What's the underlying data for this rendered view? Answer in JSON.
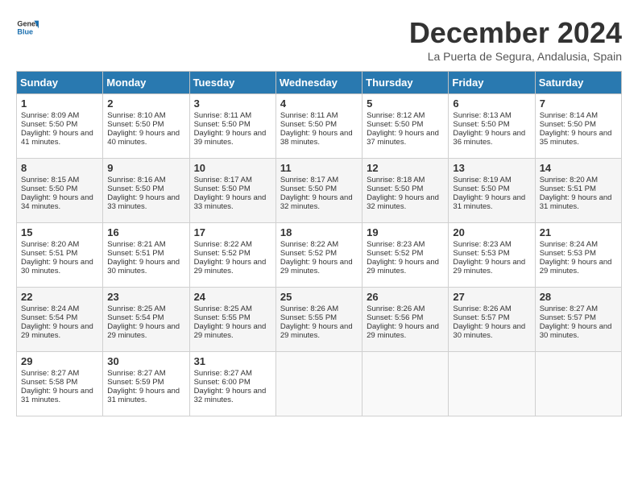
{
  "header": {
    "logo_line1": "General",
    "logo_line2": "Blue",
    "month": "December 2024",
    "location": "La Puerta de Segura, Andalusia, Spain"
  },
  "days_of_week": [
    "Sunday",
    "Monday",
    "Tuesday",
    "Wednesday",
    "Thursday",
    "Friday",
    "Saturday"
  ],
  "weeks": [
    [
      {
        "day": "1",
        "sunrise": "Sunrise: 8:09 AM",
        "sunset": "Sunset: 5:50 PM",
        "daylight": "Daylight: 9 hours and 41 minutes."
      },
      {
        "day": "2",
        "sunrise": "Sunrise: 8:10 AM",
        "sunset": "Sunset: 5:50 PM",
        "daylight": "Daylight: 9 hours and 40 minutes."
      },
      {
        "day": "3",
        "sunrise": "Sunrise: 8:11 AM",
        "sunset": "Sunset: 5:50 PM",
        "daylight": "Daylight: 9 hours and 39 minutes."
      },
      {
        "day": "4",
        "sunrise": "Sunrise: 8:11 AM",
        "sunset": "Sunset: 5:50 PM",
        "daylight": "Daylight: 9 hours and 38 minutes."
      },
      {
        "day": "5",
        "sunrise": "Sunrise: 8:12 AM",
        "sunset": "Sunset: 5:50 PM",
        "daylight": "Daylight: 9 hours and 37 minutes."
      },
      {
        "day": "6",
        "sunrise": "Sunrise: 8:13 AM",
        "sunset": "Sunset: 5:50 PM",
        "daylight": "Daylight: 9 hours and 36 minutes."
      },
      {
        "day": "7",
        "sunrise": "Sunrise: 8:14 AM",
        "sunset": "Sunset: 5:50 PM",
        "daylight": "Daylight: 9 hours and 35 minutes."
      }
    ],
    [
      {
        "day": "8",
        "sunrise": "Sunrise: 8:15 AM",
        "sunset": "Sunset: 5:50 PM",
        "daylight": "Daylight: 9 hours and 34 minutes."
      },
      {
        "day": "9",
        "sunrise": "Sunrise: 8:16 AM",
        "sunset": "Sunset: 5:50 PM",
        "daylight": "Daylight: 9 hours and 33 minutes."
      },
      {
        "day": "10",
        "sunrise": "Sunrise: 8:17 AM",
        "sunset": "Sunset: 5:50 PM",
        "daylight": "Daylight: 9 hours and 33 minutes."
      },
      {
        "day": "11",
        "sunrise": "Sunrise: 8:17 AM",
        "sunset": "Sunset: 5:50 PM",
        "daylight": "Daylight: 9 hours and 32 minutes."
      },
      {
        "day": "12",
        "sunrise": "Sunrise: 8:18 AM",
        "sunset": "Sunset: 5:50 PM",
        "daylight": "Daylight: 9 hours and 32 minutes."
      },
      {
        "day": "13",
        "sunrise": "Sunrise: 8:19 AM",
        "sunset": "Sunset: 5:50 PM",
        "daylight": "Daylight: 9 hours and 31 minutes."
      },
      {
        "day": "14",
        "sunrise": "Sunrise: 8:20 AM",
        "sunset": "Sunset: 5:51 PM",
        "daylight": "Daylight: 9 hours and 31 minutes."
      }
    ],
    [
      {
        "day": "15",
        "sunrise": "Sunrise: 8:20 AM",
        "sunset": "Sunset: 5:51 PM",
        "daylight": "Daylight: 9 hours and 30 minutes."
      },
      {
        "day": "16",
        "sunrise": "Sunrise: 8:21 AM",
        "sunset": "Sunset: 5:51 PM",
        "daylight": "Daylight: 9 hours and 30 minutes."
      },
      {
        "day": "17",
        "sunrise": "Sunrise: 8:22 AM",
        "sunset": "Sunset: 5:52 PM",
        "daylight": "Daylight: 9 hours and 29 minutes."
      },
      {
        "day": "18",
        "sunrise": "Sunrise: 8:22 AM",
        "sunset": "Sunset: 5:52 PM",
        "daylight": "Daylight: 9 hours and 29 minutes."
      },
      {
        "day": "19",
        "sunrise": "Sunrise: 8:23 AM",
        "sunset": "Sunset: 5:52 PM",
        "daylight": "Daylight: 9 hours and 29 minutes."
      },
      {
        "day": "20",
        "sunrise": "Sunrise: 8:23 AM",
        "sunset": "Sunset: 5:53 PM",
        "daylight": "Daylight: 9 hours and 29 minutes."
      },
      {
        "day": "21",
        "sunrise": "Sunrise: 8:24 AM",
        "sunset": "Sunset: 5:53 PM",
        "daylight": "Daylight: 9 hours and 29 minutes."
      }
    ],
    [
      {
        "day": "22",
        "sunrise": "Sunrise: 8:24 AM",
        "sunset": "Sunset: 5:54 PM",
        "daylight": "Daylight: 9 hours and 29 minutes."
      },
      {
        "day": "23",
        "sunrise": "Sunrise: 8:25 AM",
        "sunset": "Sunset: 5:54 PM",
        "daylight": "Daylight: 9 hours and 29 minutes."
      },
      {
        "day": "24",
        "sunrise": "Sunrise: 8:25 AM",
        "sunset": "Sunset: 5:55 PM",
        "daylight": "Daylight: 9 hours and 29 minutes."
      },
      {
        "day": "25",
        "sunrise": "Sunrise: 8:26 AM",
        "sunset": "Sunset: 5:55 PM",
        "daylight": "Daylight: 9 hours and 29 minutes."
      },
      {
        "day": "26",
        "sunrise": "Sunrise: 8:26 AM",
        "sunset": "Sunset: 5:56 PM",
        "daylight": "Daylight: 9 hours and 29 minutes."
      },
      {
        "day": "27",
        "sunrise": "Sunrise: 8:26 AM",
        "sunset": "Sunset: 5:57 PM",
        "daylight": "Daylight: 9 hours and 30 minutes."
      },
      {
        "day": "28",
        "sunrise": "Sunrise: 8:27 AM",
        "sunset": "Sunset: 5:57 PM",
        "daylight": "Daylight: 9 hours and 30 minutes."
      }
    ],
    [
      {
        "day": "29",
        "sunrise": "Sunrise: 8:27 AM",
        "sunset": "Sunset: 5:58 PM",
        "daylight": "Daylight: 9 hours and 31 minutes."
      },
      {
        "day": "30",
        "sunrise": "Sunrise: 8:27 AM",
        "sunset": "Sunset: 5:59 PM",
        "daylight": "Daylight: 9 hours and 31 minutes."
      },
      {
        "day": "31",
        "sunrise": "Sunrise: 8:27 AM",
        "sunset": "Sunset: 6:00 PM",
        "daylight": "Daylight: 9 hours and 32 minutes."
      },
      null,
      null,
      null,
      null
    ]
  ]
}
